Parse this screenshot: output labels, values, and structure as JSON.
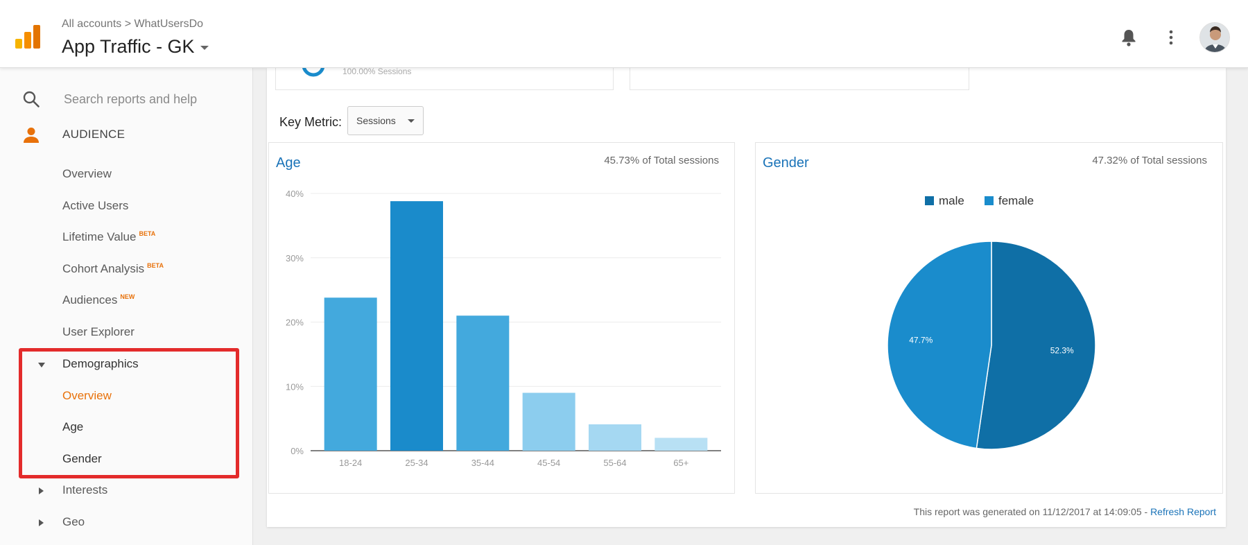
{
  "header": {
    "breadcrumb": "All accounts > WhatUsersDo",
    "property": "App Traffic - GK"
  },
  "sidebar": {
    "search_placeholder": "Search reports and help",
    "section": "AUDIENCE",
    "items": [
      {
        "label": "Overview"
      },
      {
        "label": "Active Users"
      },
      {
        "label": "Lifetime Value",
        "badge": "BETA"
      },
      {
        "label": "Cohort Analysis",
        "badge": "BETA"
      },
      {
        "label": "Audiences",
        "badge": "NEW"
      },
      {
        "label": "User Explorer"
      }
    ],
    "demographics": {
      "label": "Demographics",
      "children": [
        "Overview",
        "Age",
        "Gender"
      ]
    },
    "interests": "Interests",
    "geo": "Geo"
  },
  "main": {
    "key_metric_label": "Key Metric:",
    "key_metric_value": "Sessions",
    "top_card_text": "100.00% Sessions",
    "age": {
      "title": "Age",
      "total": "45.73% of Total sessions"
    },
    "gender": {
      "title": "Gender",
      "total": "47.32% of Total sessions",
      "legend": [
        "male",
        "female"
      ]
    },
    "footer": "This report was generated on 11/12/2017 at 14:09:05 -",
    "refresh": "Refresh Report"
  },
  "colors": {
    "accent_orange": "#e8710a",
    "link_blue": "#1a73b8",
    "highlight_red": "#e32b2b"
  },
  "chart_data": [
    {
      "type": "bar",
      "title": "Age",
      "categories": [
        "18-24",
        "25-34",
        "35-44",
        "45-54",
        "55-64",
        "65+"
      ],
      "values": [
        23.8,
        38.8,
        21.0,
        9.0,
        4.1,
        2.0
      ],
      "ylim": [
        0,
        40
      ],
      "yticks": [
        "0%",
        "10%",
        "20%",
        "30%",
        "40%"
      ],
      "colors": [
        "#43a9dd",
        "#1a8bcb",
        "#43a9dd",
        "#8ccdee",
        "#a5d8f2",
        "#b8e0f4"
      ],
      "grid": true
    },
    {
      "type": "pie",
      "title": "Gender",
      "labels": [
        "male",
        "female"
      ],
      "values": [
        52.3,
        47.7
      ],
      "value_labels": [
        "52.3%",
        "47.7%"
      ],
      "colors": [
        "#0f6fa6",
        "#1a8ccc"
      ],
      "legend": "top"
    }
  ]
}
